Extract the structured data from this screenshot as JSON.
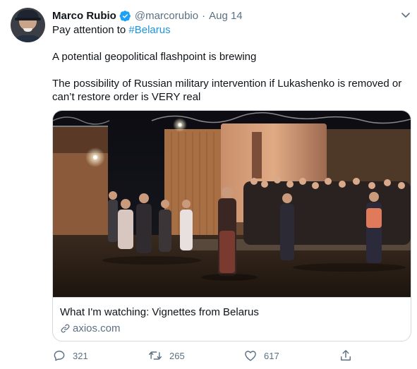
{
  "author": {
    "name": "Marco Rubio",
    "handle": "@marcorubio",
    "separator": "·",
    "date": "Aug 14",
    "verified": true
  },
  "tweet": {
    "line1_prefix": "Pay attention to ",
    "line1_hashtag": "#Belarus",
    "line2": "A potential geopolitical flashpoint is brewing",
    "line3": "The possibility of Russian military intervention if Lukashenko is removed or",
    "line4": "can’t restore order is VERY real"
  },
  "card": {
    "title": "What I'm watching: Vignettes from Belarus",
    "domain": "axios.com"
  },
  "actions": {
    "replies": "321",
    "retweets": "265",
    "likes": "617"
  },
  "icons": {
    "verified": "verified-badge-icon",
    "more": "chevron-down-icon",
    "link": "link-icon",
    "reply": "reply-icon",
    "retweet": "retweet-icon",
    "like": "heart-icon",
    "share": "share-icon"
  },
  "colors": {
    "link_blue": "#1b95e0",
    "secondary_text": "#5b7083",
    "border": "#cfd9de"
  }
}
